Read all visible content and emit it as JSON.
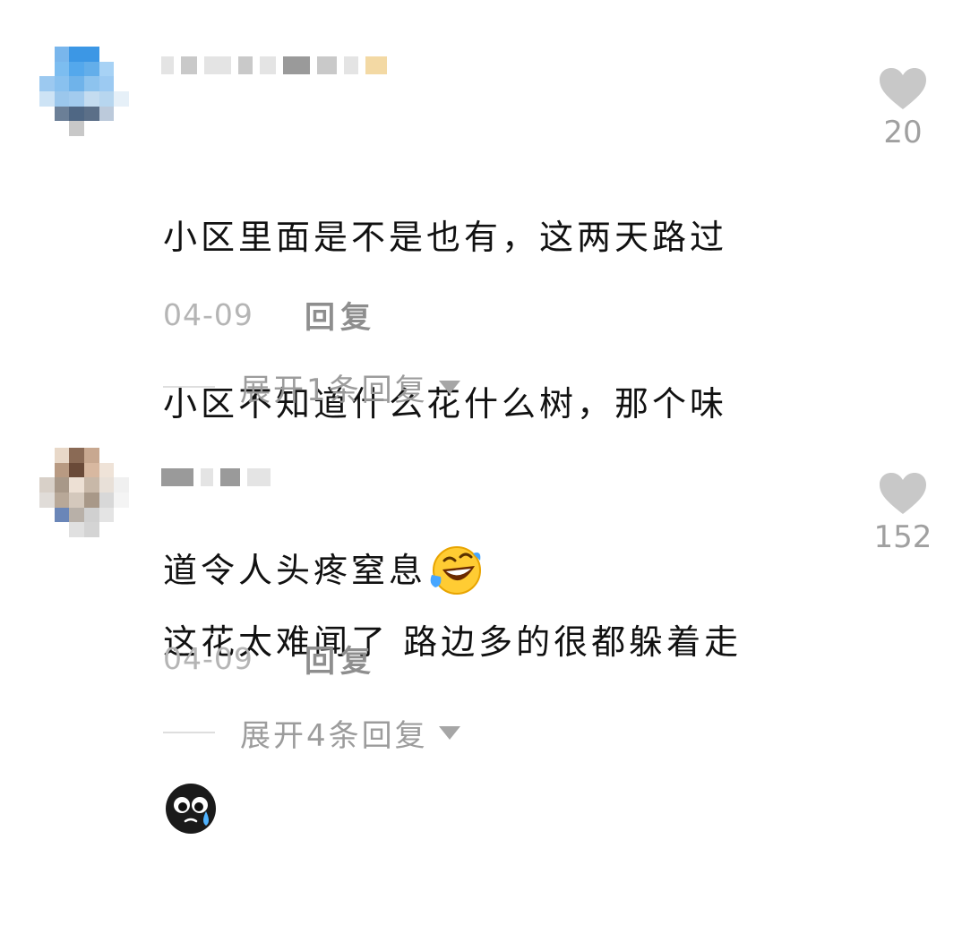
{
  "comments": [
    {
      "text_line1": "小区里面是不是也有，这两天路过",
      "text_line2": "小区不知道什么花什么树，那个味",
      "text_line3": "道令人头疼窒息",
      "emoji": "laughing-crying-face-icon",
      "date": "04-09",
      "reply_label": "回复",
      "expand_label": "展开1条回复",
      "like_count": "20"
    },
    {
      "text_line1": "这花太难闻了 路边多的很都躲着走",
      "emoji": "black-crying-face-icon",
      "date": "04-09",
      "reply_label": "回复",
      "expand_label": "展开4条回复",
      "like_count": "152"
    }
  ],
  "colors": {
    "text": "#111111",
    "meta": "#b5b5b5",
    "like": "#c8c8c8"
  }
}
